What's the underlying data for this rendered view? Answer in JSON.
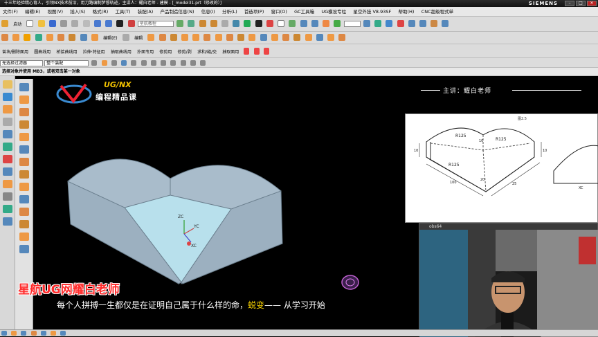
{
  "window": {
    "title": "十三年经验精心育人，引领NX技术前沿，用刀路编制梦想轨迹，主讲人：耀白老师 - 建模 - [_model31.prt（修改的）]",
    "brand": "SIEMENS",
    "controls": [
      "–",
      "□",
      "✕"
    ]
  },
  "menu": [
    "文件(F)",
    "编辑(E)",
    "视图(V)",
    "插入(S)",
    "格式(R)",
    "工具(T)",
    "装配(A)",
    "产品制造信息(N)",
    "信息(I)",
    "分析(L)",
    "首选项(P)",
    "窗口(O)",
    "GC工具箱",
    "UG模设专柱",
    "星空外挂 V8.93SF",
    "帮助(H)",
    "CNC超级程式单"
  ],
  "toolbar1": {
    "start_label": "启动",
    "search_placeholder": "星航教程"
  },
  "toolbar2": {
    "edit_label": "编辑(E)",
    "sub_label": "编辑"
  },
  "toolbar3": [
    "曾块/删除面用",
    "圆曲线用",
    "桥接曲线用",
    "拉伸·特征用",
    "抽取曲线用",
    "扑面专用",
    "修剪用",
    "修剪/剥",
    "求和/缝/交",
    "抽取面用"
  ],
  "toolbar4": {
    "filter_label": "无选择过滤器",
    "assembly_label": "整个装配"
  },
  "hint": "选择对象并使用 MB3，或者双击某一对象",
  "logo": {
    "top": "UG/NX",
    "bottom": "编程精品课"
  },
  "teacher": "主讲：耀白老师",
  "brand_red": "星航UG网耀白老师",
  "subtitle": {
    "main": "每个人拼搏一生都仅是在证明自己属于什么样的命，",
    "highlight": "蜕变",
    "tail": "—— 从学习开始"
  },
  "reference": {
    "fig_label": "图2.5",
    "r1": "R125",
    "r2": "R125",
    "r3": "R125",
    "d1": "10",
    "d2": "100",
    "d3": "10",
    "d4": "25",
    "d5": "10",
    "d6": "20",
    "xc": "XC"
  },
  "axes": {
    "zc": "ZC",
    "yc": "YC",
    "xc": "XC"
  },
  "camera": {
    "title": "obs64"
  },
  "colors": {
    "model_face": "#a9bccb",
    "model_light": "#b8e0ec",
    "accent_yellow": "#f2c200",
    "brand_red": "#ff2a2a"
  }
}
